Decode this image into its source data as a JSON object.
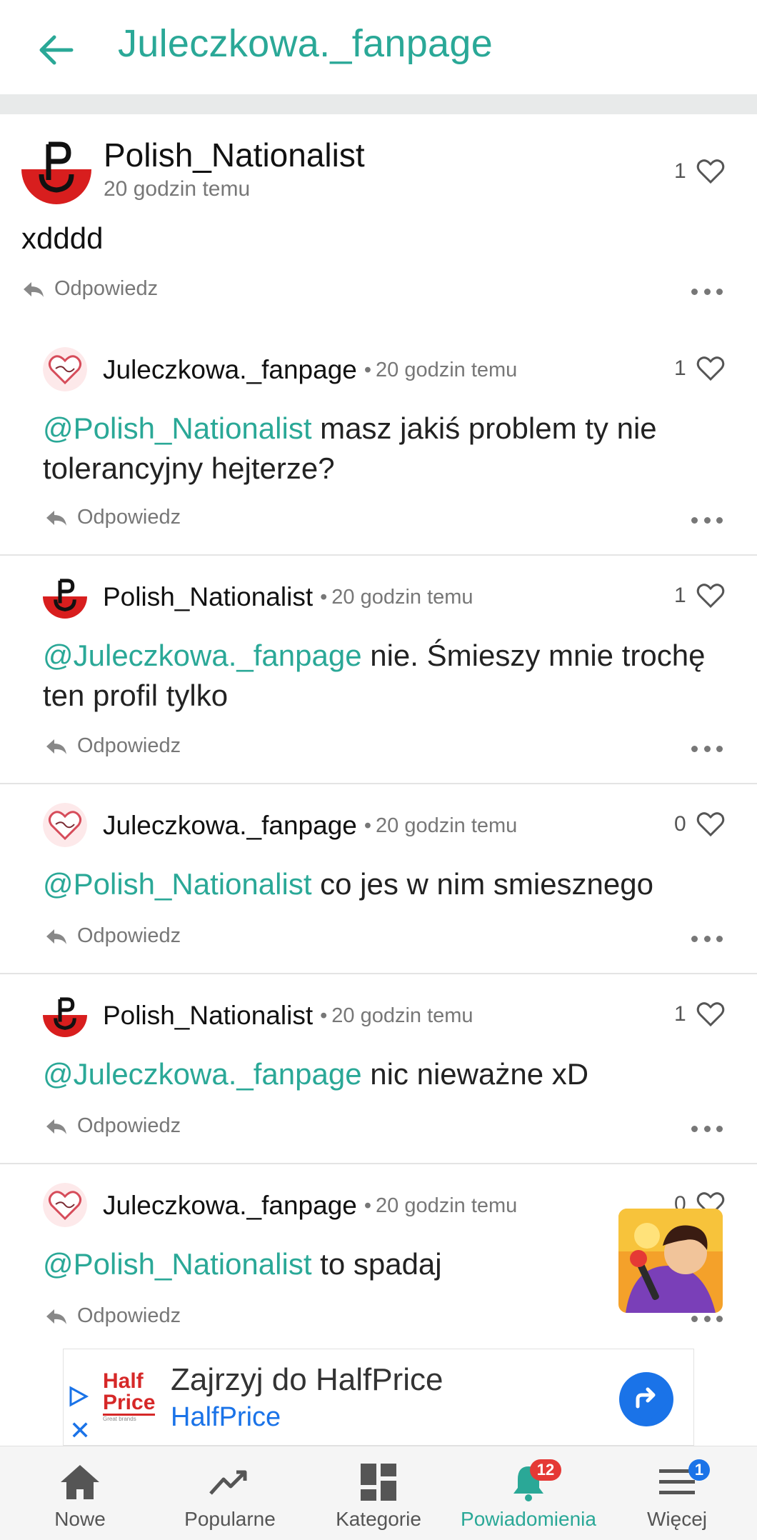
{
  "header": {
    "title": "Juleczkowa._fanpage"
  },
  "main_comment": {
    "author": "Polish_Nationalist",
    "time": "20 godzin temu",
    "text": "xdddd",
    "likes": "1",
    "reply_label": "Odpowiedz"
  },
  "replies": [
    {
      "author": "Juleczkowa._fanpage",
      "separator": "•",
      "time": "20 godzin temu",
      "likes": "1",
      "mention": "@Polish_Nationalist",
      "text": " masz jakiś problem ty nie tolerancyjny hejterze?",
      "reply_label": "Odpowiedz"
    },
    {
      "author": "Polish_Nationalist",
      "separator": "•",
      "time": "20 godzin temu",
      "likes": "1",
      "mention": "@Juleczkowa._fanpage",
      "text": " nie. Śmieszy mnie trochę ten profil tylko",
      "reply_label": "Odpowiedz"
    },
    {
      "author": "Juleczkowa._fanpage",
      "separator": "•",
      "time": "20 godzin temu",
      "likes": "0",
      "mention": "@Polish_Nationalist",
      "text": " co jes w nim smiesznego",
      "reply_label": "Odpowiedz"
    },
    {
      "author": "Polish_Nationalist",
      "separator": "•",
      "time": "20 godzin temu",
      "likes": "1",
      "mention": "@Juleczkowa._fanpage",
      "text": " nic nieważne xD",
      "reply_label": "Odpowiedz"
    },
    {
      "author": "Juleczkowa._fanpage",
      "separator": "•",
      "time": "20 godzin temu",
      "likes": "0",
      "mention": "@Polish_Nationalist",
      "text": " to spadaj",
      "reply_label": "Odpowiedz"
    }
  ],
  "ad": {
    "title": "Zajrzyj do HalfPrice",
    "advertiser": "HalfPrice",
    "logo_line1": "Half",
    "logo_line2": "Price",
    "logo_tagline": "Great brands"
  },
  "bottom_nav": {
    "tabs": [
      {
        "label": "Nowe",
        "icon": "home-icon"
      },
      {
        "label": "Popularne",
        "icon": "trending-icon"
      },
      {
        "label": "Kategorie",
        "icon": "categories-icon"
      },
      {
        "label": "Powiadomienia",
        "icon": "bell-icon",
        "badge": "12",
        "active": true
      },
      {
        "label": "Więcej",
        "icon": "menu-icon",
        "badge": "1"
      }
    ]
  },
  "colors": {
    "accent": "#2aa897",
    "badge_red": "#e53935",
    "badge_blue": "#1a73e8"
  }
}
